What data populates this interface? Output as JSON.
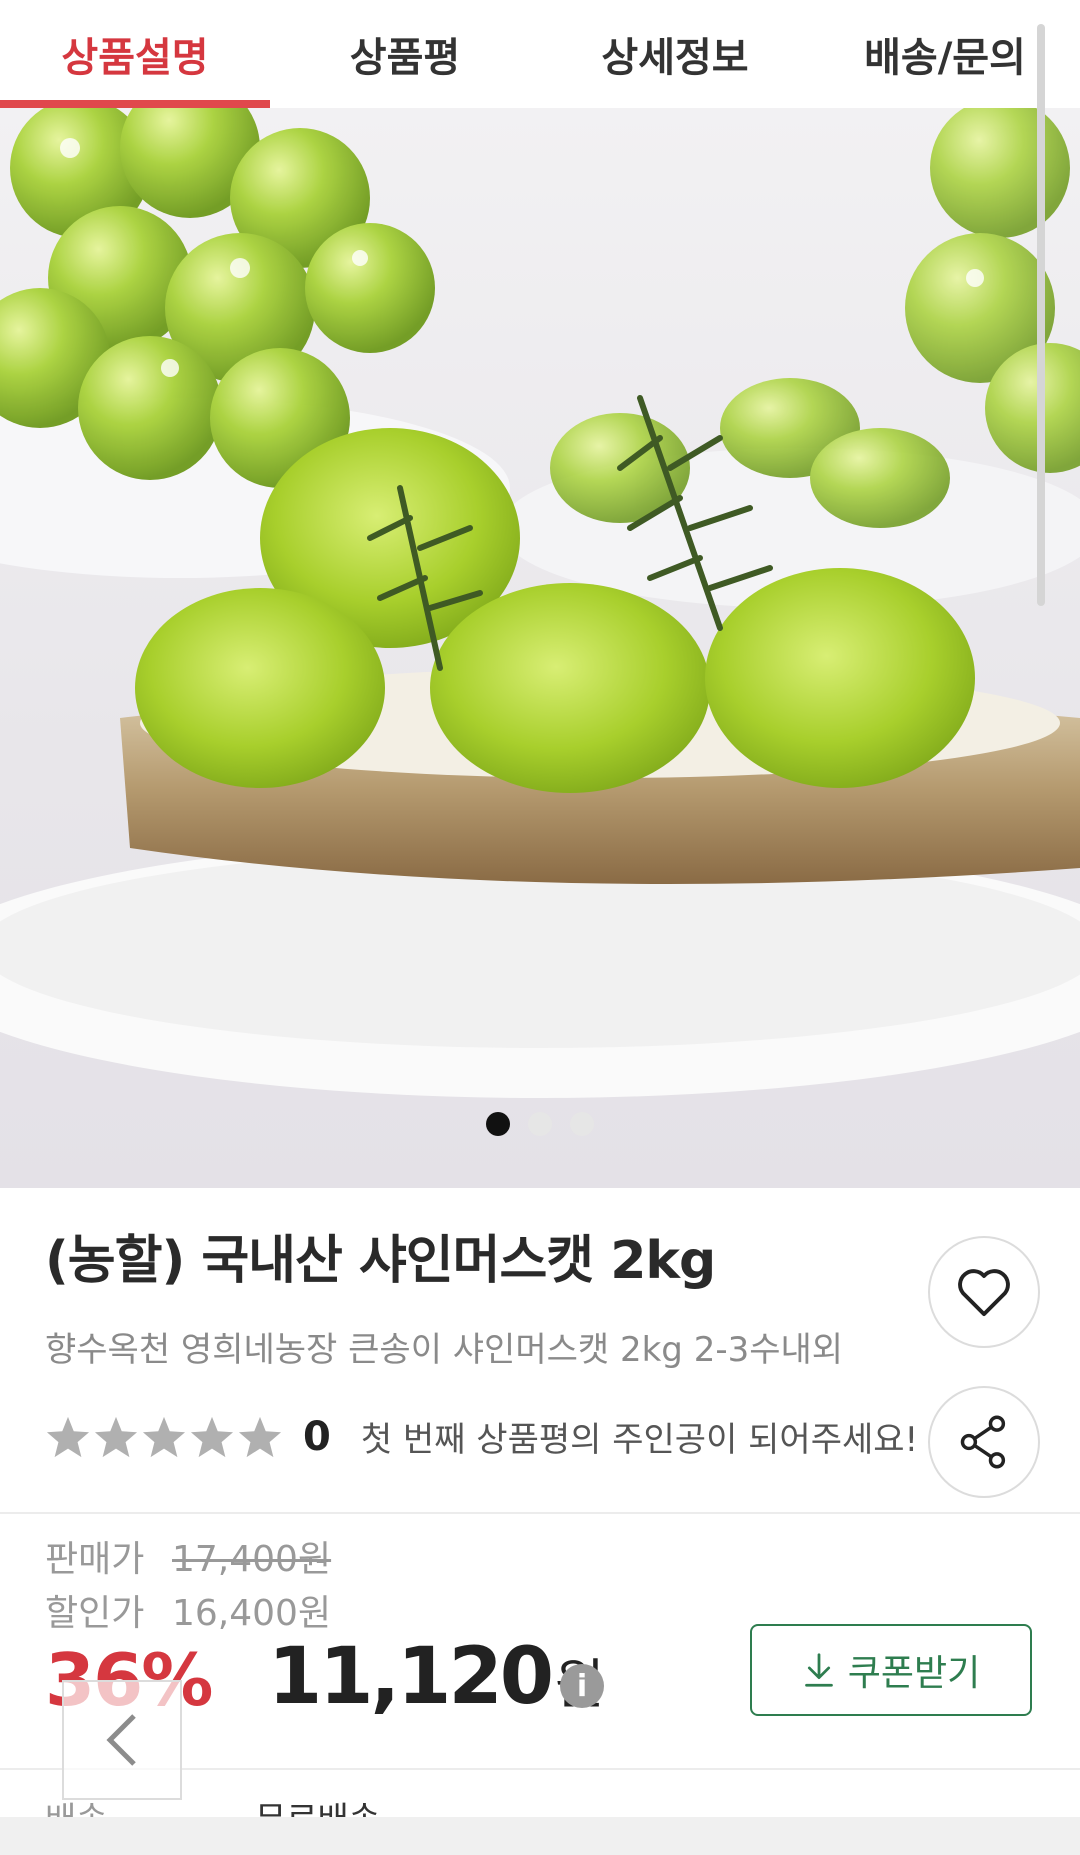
{
  "tabs": [
    {
      "label": "상품설명",
      "active": true
    },
    {
      "label": "상품평",
      "active": false
    },
    {
      "label": "상세정보",
      "active": false
    },
    {
      "label": "배송/문의",
      "active": false
    }
  ],
  "carousel": {
    "count": 3,
    "current": 1
  },
  "product": {
    "title": "(농할) 국내산 샤인머스캣 2kg",
    "subtitle": "향수옥천 영희네농장 큰송이 샤인머스캣 2kg 2-3수내외",
    "rating": {
      "stars": 0,
      "max_stars": 5,
      "count": "0",
      "message": "첫 번째 상품평의 주인공이 되어주세요!"
    }
  },
  "price": {
    "sale_label": "판매가",
    "sale_value": "17,400원",
    "discount_label": "할인가",
    "discount_value": "16,400원",
    "discount_rate": "36%",
    "final_amount": "11,120",
    "final_unit": "원",
    "info_icon_text": "i",
    "coupon_label": "쿠폰받기"
  },
  "shipping": {
    "label": "배송",
    "value": "무료배송"
  },
  "colors": {
    "accent": "#d5373f",
    "coupon": "#2e7d4f",
    "star": "#b0b0b0"
  },
  "icons": [
    "heart-icon",
    "share-icon",
    "download-icon",
    "info-icon",
    "chevron-left-icon",
    "star-icon"
  ]
}
